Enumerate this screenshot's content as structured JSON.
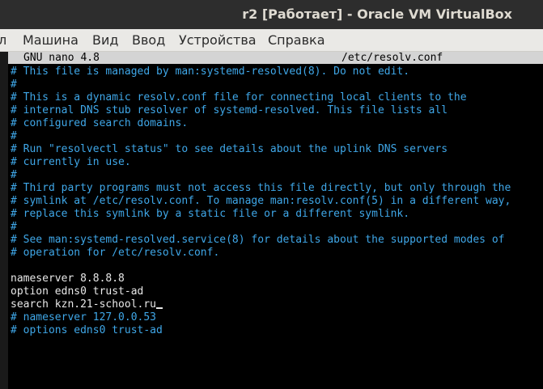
{
  "window": {
    "title": "r2 [Работает] - Oracle VM VirtualBox"
  },
  "menubar": {
    "items": [
      "л",
      "Машина",
      "Вид",
      "Ввод",
      "Устройства",
      "Справка"
    ]
  },
  "nano": {
    "version": "GNU nano 4.8",
    "filename": "/etc/resolv.conf"
  },
  "file_lines": [
    {
      "text": "# This file is managed by man:systemd-resolved(8). Do not edit.",
      "type": "comment"
    },
    {
      "text": "#",
      "type": "comment"
    },
    {
      "text": "# This is a dynamic resolv.conf file for connecting local clients to the",
      "type": "comment"
    },
    {
      "text": "# internal DNS stub resolver of systemd-resolved. This file lists all",
      "type": "comment"
    },
    {
      "text": "# configured search domains.",
      "type": "comment"
    },
    {
      "text": "#",
      "type": "comment"
    },
    {
      "text": "# Run \"resolvectl status\" to see details about the uplink DNS servers",
      "type": "comment"
    },
    {
      "text": "# currently in use.",
      "type": "comment"
    },
    {
      "text": "#",
      "type": "comment"
    },
    {
      "text": "# Third party programs must not access this file directly, but only through the",
      "type": "comment"
    },
    {
      "text": "# symlink at /etc/resolv.conf. To manage man:resolv.conf(5) in a different way,",
      "type": "comment"
    },
    {
      "text": "# replace this symlink by a static file or a different symlink.",
      "type": "comment"
    },
    {
      "text": "#",
      "type": "comment"
    },
    {
      "text": "# See man:systemd-resolved.service(8) for details about the supported modes of",
      "type": "comment"
    },
    {
      "text": "# operation for /etc/resolv.conf.",
      "type": "comment"
    },
    {
      "text": "",
      "type": "plain"
    },
    {
      "text": "nameserver 8.8.8.8",
      "type": "plain"
    },
    {
      "text": "option edns0 trust-ad",
      "type": "plain"
    },
    {
      "text": "search kzn.21-school.ru",
      "type": "plain",
      "cursor": true
    },
    {
      "text": "# nameserver 127.0.0.53",
      "type": "comment"
    },
    {
      "text": "# options edns0 trust-ad",
      "type": "comment"
    }
  ],
  "colors": {
    "comment": "#3fa7e8",
    "text": "#e8e8e8",
    "background": "#000000",
    "header_bg": "#d4d4d4"
  }
}
